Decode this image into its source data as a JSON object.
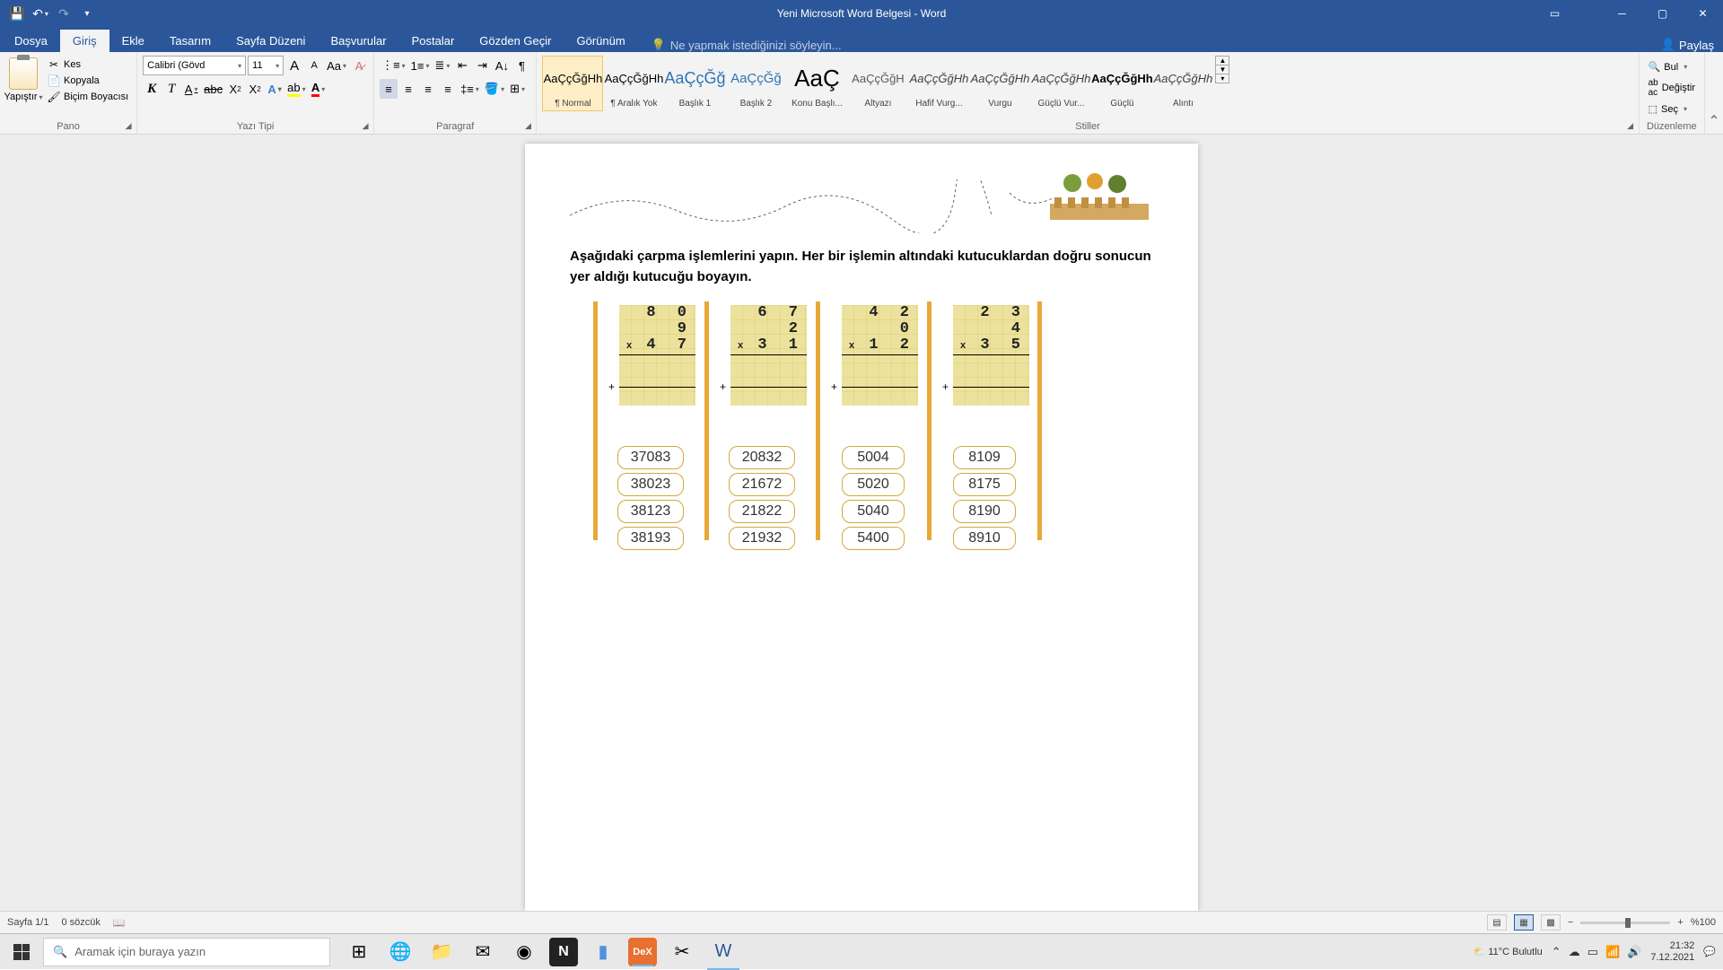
{
  "title": "Yeni Microsoft Word Belgesi - Word",
  "tabs": {
    "file": "Dosya",
    "home": "Giriş",
    "insert": "Ekle",
    "design": "Tasarım",
    "layout": "Sayfa Düzeni",
    "references": "Başvurular",
    "mailings": "Postalar",
    "review": "Gözden Geçir",
    "view": "Görünüm"
  },
  "tellme": "Ne yapmak istediğinizi söyleyin...",
  "share": "Paylaş",
  "clipboard": {
    "paste": "Yapıştır",
    "cut": "Kes",
    "copy": "Kopyala",
    "painter": "Biçim Boyacısı",
    "label": "Pano"
  },
  "font": {
    "name": "Calibri (Gövd",
    "size": "11",
    "label": "Yazı Tipi"
  },
  "paragraph": {
    "label": "Paragraf"
  },
  "styles": {
    "label": "Stiller",
    "items": [
      {
        "preview": "AaÇçĞğHh",
        "name": "¶ Normal",
        "color": "#000",
        "selected": true
      },
      {
        "preview": "AaÇçĞğHh",
        "name": "¶ Aralık Yok",
        "color": "#000"
      },
      {
        "preview": "AaÇçĞğ",
        "name": "Başlık 1",
        "color": "#2e74b5",
        "size": "18px"
      },
      {
        "preview": "AaÇçĞğ",
        "name": "Başlık 2",
        "color": "#2e74b5",
        "size": "15px"
      },
      {
        "preview": "AaÇ",
        "name": "Konu Başlı...",
        "color": "#000",
        "size": "26px"
      },
      {
        "preview": "AaÇçĞğH",
        "name": "Altyazı",
        "color": "#5a5a5a"
      },
      {
        "preview": "AaÇçĞğHh",
        "name": "Hafif Vurg...",
        "color": "#404040",
        "italic": true
      },
      {
        "preview": "AaÇçĞğHh",
        "name": "Vurgu",
        "color": "#404040",
        "italic": true
      },
      {
        "preview": "AaÇçĞğHh",
        "name": "Güçlü Vur...",
        "color": "#404040",
        "italic": true
      },
      {
        "preview": "AaÇçĞğHh",
        "name": "Güçlü",
        "color": "#000",
        "bold": true
      },
      {
        "preview": "AaÇçĞğHh",
        "name": "Alıntı",
        "color": "#404040",
        "italic": true
      }
    ]
  },
  "editing": {
    "find": "Bul",
    "replace": "Değiştir",
    "select": "Seç",
    "label": "Düzenleme"
  },
  "doc": {
    "instruction": "Aşağıdaki çarpma işlemlerini yapın. Her bir işlemin altındaki kutucuklardan doğru sonucun yer aldığı kutucuğu boyayın.",
    "problems": [
      {
        "top": "8 0 9",
        "bottom": "4 7",
        "answers": [
          "37083",
          "38023",
          "38123",
          "38193"
        ]
      },
      {
        "top": "6 7 2",
        "bottom": "3 1",
        "answers": [
          "20832",
          "21672",
          "21822",
          "21932"
        ]
      },
      {
        "top": "4 2 0",
        "bottom": "1 2",
        "answers": [
          "5004",
          "5020",
          "5040",
          "5400"
        ]
      },
      {
        "top": "2 3 4",
        "bottom": "3 5",
        "answers": [
          "8109",
          "8175",
          "8190",
          "8910"
        ]
      }
    ]
  },
  "statusbar": {
    "page": "Sayfa 1/1",
    "words": "0 sözcük",
    "zoom": "%100"
  },
  "taskbar": {
    "search": "Aramak için buraya yazın",
    "weather": "11°C  Bulutlu",
    "time": "21:32",
    "date": "7.12.2021"
  }
}
